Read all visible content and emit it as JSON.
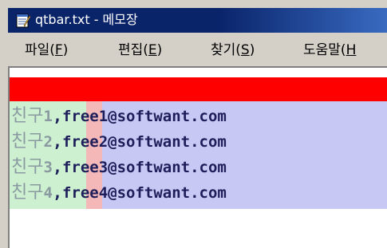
{
  "window": {
    "title": "qtbar.txt - 메모장",
    "icon": "notepad-icon"
  },
  "menu": [
    {
      "label": "파일(",
      "accel": "F",
      "close": ")"
    },
    {
      "label": "편집(",
      "accel": "E",
      "close": ")"
    },
    {
      "label": "찾기(",
      "accel": "S",
      "close": ")"
    },
    {
      "label": "도움말(",
      "accel": "H",
      "close": ""
    }
  ],
  "editor": {
    "highlight_colors": {
      "row_band": "#ff0000",
      "name_column": "#ccf0d0",
      "comma_column": "#f4b8b8",
      "email_column": "#c8c8f4"
    },
    "lines": [
      {
        "name": "친구",
        "num": "1",
        "sep": ",",
        "email": "free1@softwant.com"
      },
      {
        "name": "친구",
        "num": "2",
        "sep": ",",
        "email": "free2@softwant.com"
      },
      {
        "name": "친구",
        "num": "3",
        "sep": ",",
        "email": "free3@softwant.com"
      },
      {
        "name": "친구",
        "num": "4",
        "sep": ",",
        "email": "free4@softwant.com"
      }
    ]
  }
}
